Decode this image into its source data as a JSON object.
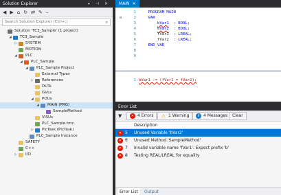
{
  "solution_explorer": {
    "title": "Solution Explorer",
    "search_placeholder": "Search Solution Explorer (Ctrl+;)",
    "tree": [
      {
        "label": "Solution 'TC3_Sample' (1 project)",
        "depth": 0,
        "toggle": "",
        "icon": "solution",
        "color": "#6a6a6a"
      },
      {
        "label": "TC3_Sample",
        "depth": 1,
        "toggle": "◢",
        "icon": "project",
        "color": "#1c79d1"
      },
      {
        "label": "SYSTEM",
        "depth": 2,
        "toggle": "▷",
        "icon": "system",
        "color": "#d08a1c"
      },
      {
        "label": "MOTION",
        "depth": 2,
        "toggle": "",
        "icon": "motion",
        "color": "#6aa84f"
      },
      {
        "label": "PLC",
        "depth": 2,
        "toggle": "◢",
        "icon": "plc",
        "color": "#d9601c"
      },
      {
        "label": "PLC_Sample",
        "depth": 3,
        "toggle": "◢",
        "icon": "plc-project",
        "color": "#d9601c"
      },
      {
        "label": "PLC_Sample Project",
        "depth": 4,
        "toggle": "◢",
        "icon": "plc-proj",
        "color": "#5b8bc7"
      },
      {
        "label": "External Types",
        "depth": 5,
        "toggle": "",
        "icon": "folder",
        "color": "#e8c35a"
      },
      {
        "label": "References",
        "depth": 5,
        "toggle": "▷",
        "icon": "references",
        "color": "#6a6a6a"
      },
      {
        "label": "DUTs",
        "depth": 5,
        "toggle": "",
        "icon": "folder",
        "color": "#e8c35a"
      },
      {
        "label": "GVLs",
        "depth": 5,
        "toggle": "",
        "icon": "folder",
        "color": "#e8c35a"
      },
      {
        "label": "POUs",
        "depth": 5,
        "toggle": "◢",
        "icon": "folder",
        "color": "#e8c35a"
      },
      {
        "label": "MAIN (PRG)",
        "depth": 6,
        "toggle": "◢",
        "icon": "program",
        "color": "#5b8bc7",
        "selected": true
      },
      {
        "label": "SampleMethod",
        "depth": 7,
        "toggle": "",
        "icon": "method",
        "color": "#8a5bc7"
      },
      {
        "label": "VISUs",
        "depth": 5,
        "toggle": "",
        "icon": "folder",
        "color": "#e8c35a"
      },
      {
        "label": "PLC_Sample.tmc",
        "depth": 5,
        "toggle": "",
        "icon": "tmc",
        "color": "#6aa84f"
      },
      {
        "label": "PlcTask (PlcTask)",
        "depth": 5,
        "toggle": "▷",
        "icon": "task",
        "color": "#1c79d1"
      },
      {
        "label": "PLC_Sample Instance",
        "depth": 4,
        "toggle": "",
        "icon": "instance",
        "color": "#5b8bc7"
      },
      {
        "label": "SAFETY",
        "depth": 2,
        "toggle": "",
        "icon": "safety",
        "color": "#e8c35a"
      },
      {
        "label": "C++",
        "depth": 2,
        "toggle": "",
        "icon": "cpp",
        "color": "#6aa84f"
      },
      {
        "label": "I/O",
        "depth": 2,
        "toggle": "▷",
        "icon": "io",
        "color": "#e8c35a"
      }
    ]
  },
  "editor": {
    "tab_label": "MAIN",
    "declaration_lines": [
      {
        "num": "1",
        "segments": [
          {
            "t": "    ",
            "c": ""
          },
          {
            "t": "PROGRAM MAIN",
            "c": "kw"
          }
        ]
      },
      {
        "num": "2",
        "segments": [
          {
            "t": "    ",
            "c": ""
          },
          {
            "t": "VAR",
            "c": "kw"
          }
        ]
      },
      {
        "num": "3",
        "segments": [
          {
            "t": "        ",
            "c": ""
          },
          {
            "t": "bVar1",
            "c": "var"
          },
          {
            "t": "  : ",
            "c": ""
          },
          {
            "t": "BOOL",
            "c": "kw"
          },
          {
            "t": ";",
            "c": ""
          }
        ]
      },
      {
        "num": "4",
        "segments": [
          {
            "t": "        ",
            "c": ""
          },
          {
            "t": "bVar2",
            "c": "var"
          },
          {
            "t": "  : ",
            "c": ""
          },
          {
            "t": "BOOL",
            "c": "kw"
          },
          {
            "t": ";",
            "c": ""
          }
        ]
      },
      {
        "num": "5",
        "segments": [
          {
            "t": "        ",
            "c": ""
          },
          {
            "t": "fVar1",
            "c": ""
          },
          {
            "t": "  : ",
            "c": ""
          },
          {
            "t": "LREAL",
            "c": "kw"
          },
          {
            "t": ";",
            "c": ""
          }
        ]
      },
      {
        "num": "6",
        "segments": [
          {
            "t": "        ",
            "c": ""
          },
          {
            "t": "fVar2",
            "c": ""
          },
          {
            "t": "  : ",
            "c": ""
          },
          {
            "t": "LREAL",
            "c": "kw"
          },
          {
            "t": ";",
            "c": ""
          }
        ]
      },
      {
        "num": "7",
        "segments": [
          {
            "t": "    ",
            "c": ""
          },
          {
            "t": "END_VAR",
            "c": "kw"
          }
        ]
      },
      {
        "num": "8",
        "segments": []
      },
      {
        "num": "9",
        "segments": []
      }
    ],
    "implementation_lines": [
      {
        "num": "1",
        "segments": [
          {
            "t": "bVar1 := (fVar1 = fVar2);",
            "c": "err"
          }
        ]
      }
    ]
  },
  "error_list": {
    "title": "Error List",
    "errors_count": "4 Errors",
    "warnings_count": "1 Warning",
    "messages_count": "4 Messages",
    "clear_label": "Clear",
    "description_header": "Description",
    "rows": [
      {
        "num": "5",
        "text": "Unused Variable 'bVar2'",
        "selected": true
      },
      {
        "num": "6",
        "text": "Unused Method 'SampleMethod'",
        "selected": false
      },
      {
        "num": "7",
        "text": "Invalid variable name 'fVar1'. Expect prefix 'b'",
        "selected": false
      },
      {
        "num": "8",
        "text": "Testing REAL/LREAL for equality",
        "selected": false
      }
    ],
    "bottom_tabs": [
      "Error List",
      "Output"
    ]
  },
  "colors": {
    "accent": "#007acc",
    "error": "#e51400",
    "selection": "#0078d7"
  }
}
